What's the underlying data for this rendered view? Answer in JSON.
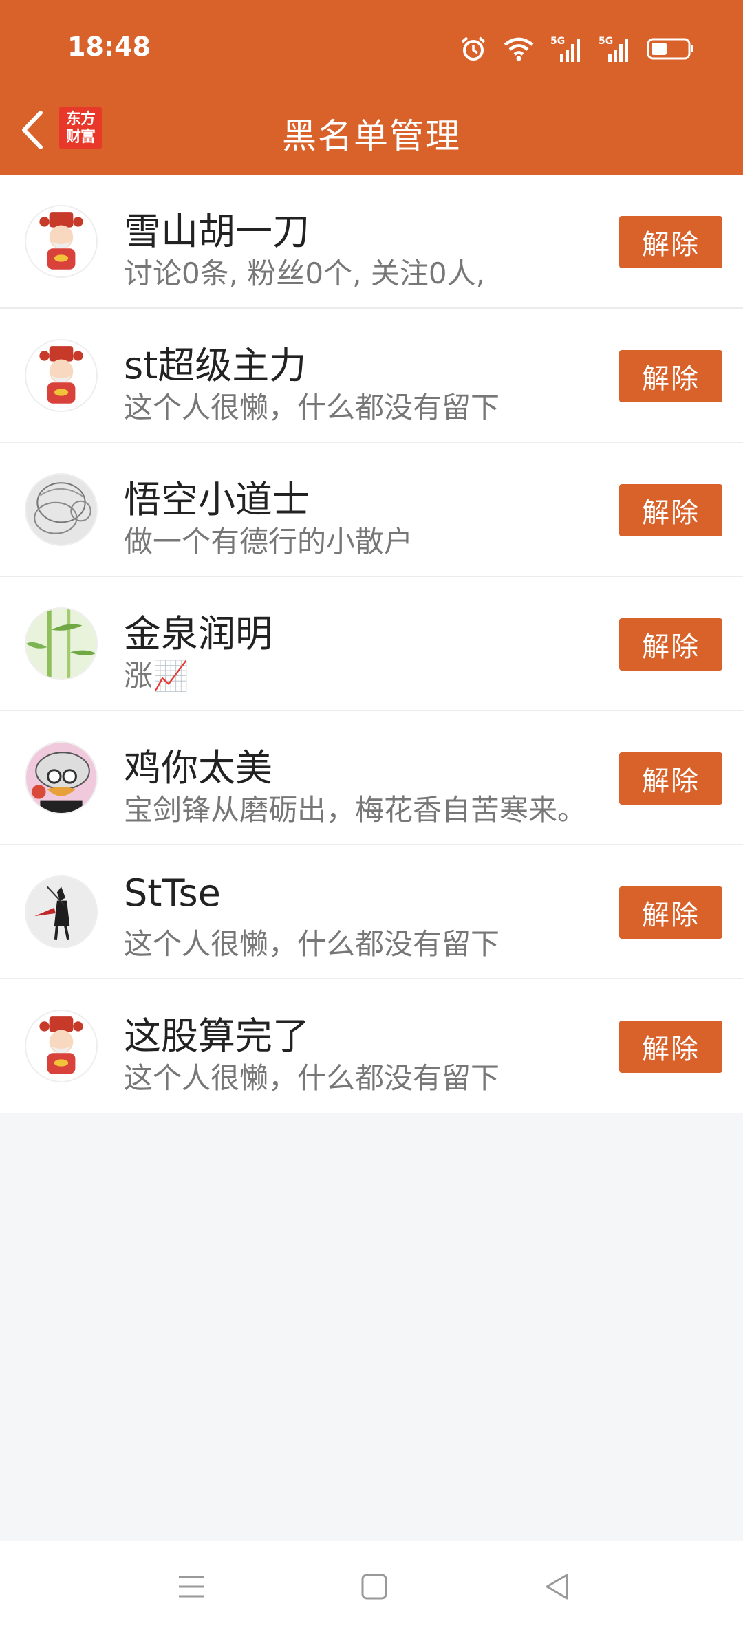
{
  "status_bar": {
    "time": "18:48",
    "icons": [
      "alarm-icon",
      "wifi-icon",
      "signal-5g-icon",
      "signal-5g-icon",
      "battery-icon"
    ],
    "net_label": "5G"
  },
  "header": {
    "title": "黑名单管理",
    "logo_line1": "东方",
    "logo_line2": "财富",
    "accent_color": "#d9612a"
  },
  "blacklist": [
    {
      "name": "雪山胡一刀",
      "desc": "讨论0条, 粉丝0个, 关注0人,",
      "action": "解除",
      "avatar": "fortune-god"
    },
    {
      "name": "st超级主力",
      "desc": "这个人很懒，什么都没有留下",
      "action": "解除",
      "avatar": "fortune-god"
    },
    {
      "name": "悟空小道士",
      "desc": "做一个有德行的小散户",
      "action": "解除",
      "avatar": "sketch"
    },
    {
      "name": "金泉润明",
      "desc": "涨📈",
      "action": "解除",
      "avatar": "bamboo"
    },
    {
      "name": "鸡你太美",
      "desc": "宝剑锋从磨砺出，梅花香自苦寒来。",
      "action": "解除",
      "avatar": "cartoon"
    },
    {
      "name": "StTse",
      "desc": "这个人很懒，什么都没有留下",
      "action": "解除",
      "avatar": "ink-figure"
    },
    {
      "name": "这股算完了",
      "desc": "这个人很懒，什么都没有留下",
      "action": "解除",
      "avatar": "fortune-god"
    }
  ],
  "nav": [
    "menu-icon",
    "home-icon",
    "back-triangle-icon"
  ]
}
